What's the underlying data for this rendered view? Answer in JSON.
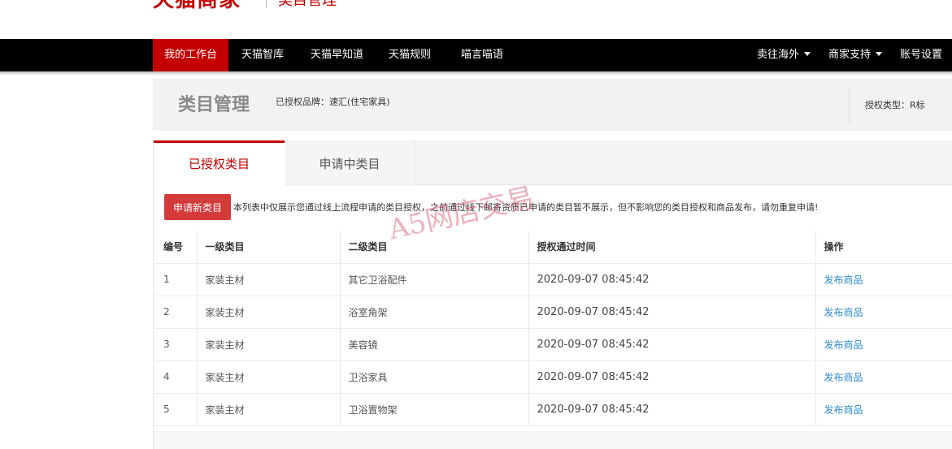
{
  "header": {
    "logo": "天猫商家",
    "subtitle": "类目管理"
  },
  "nav": {
    "left": [
      "我的工作台",
      "天猫智库",
      "天猫早知道",
      "天猫规则",
      "喵言喵语"
    ],
    "right": [
      "卖往海外",
      "商家支持",
      "账号设置"
    ]
  },
  "page": {
    "title": "类目管理",
    "brand_label": "已授权品牌：速汇(住宅家具)",
    "auth_type": "授权类型：R标"
  },
  "tabs": [
    "已授权类目",
    "申请中类目"
  ],
  "toolbar": {
    "apply_button": "申请新类目",
    "notice": "本列表中仅展示您通过线上流程申请的类目授权，之前通过线下邮寄资质已申请的类目暂不展示，但不影响您的类目授权和商品发布，请勿重复申请!"
  },
  "table": {
    "headers": [
      "编号",
      "一级类目",
      "二级类目",
      "授权通过时间",
      "操作"
    ],
    "rows": [
      [
        "1",
        "家装主材",
        "其它卫浴配件",
        "2020-09-07 08:45:42",
        "发布商品"
      ],
      [
        "2",
        "家装主材",
        "浴室角架",
        "2020-09-07 08:45:42",
        "发布商品"
      ],
      [
        "3",
        "家装主材",
        "美容镜",
        "2020-09-07 08:45:42",
        "发布商品"
      ],
      [
        "4",
        "家装主材",
        "卫浴家具",
        "2020-09-07 08:45:42",
        "发布商品"
      ],
      [
        "5",
        "家装主材",
        "卫浴置物架",
        "2020-09-07 08:45:42",
        "发布商品"
      ]
    ]
  },
  "watermark": "A5网店交易",
  "colors": {
    "brand_red": "#c40000",
    "button_red": "#d43a3a",
    "link_blue": "#2b8bd0"
  }
}
